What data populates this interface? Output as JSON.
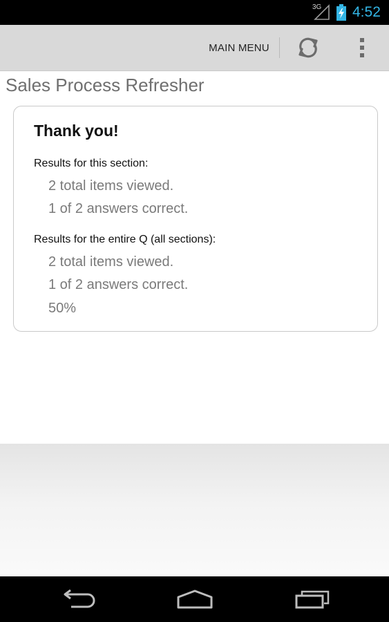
{
  "status_bar": {
    "network_type": "3G",
    "time": "4:52",
    "signal_icon": "cellular-signal-icon",
    "battery_icon": "battery-charging-icon",
    "accent_color": "#33b5e5"
  },
  "action_bar": {
    "main_menu_label": "MAIN MENU",
    "refresh_icon": "refresh-icon",
    "overflow_icon": "overflow-menu-icon"
  },
  "page": {
    "title": "Sales Process Refresher"
  },
  "results_card": {
    "heading": "Thank you!",
    "section_results_label": "Results for this section:",
    "section_items_viewed": "2 total items viewed.",
    "section_answers_correct": "1 of 2 answers correct.",
    "overall_results_label": "Results for the entire Q (all sections):",
    "overall_items_viewed": "2 total items viewed.",
    "overall_answers_correct": "1 of 2 answers correct.",
    "overall_score": "50%"
  },
  "nav_bar": {
    "back_icon": "back-icon",
    "home_icon": "home-icon",
    "recents_icon": "recent-apps-icon"
  }
}
